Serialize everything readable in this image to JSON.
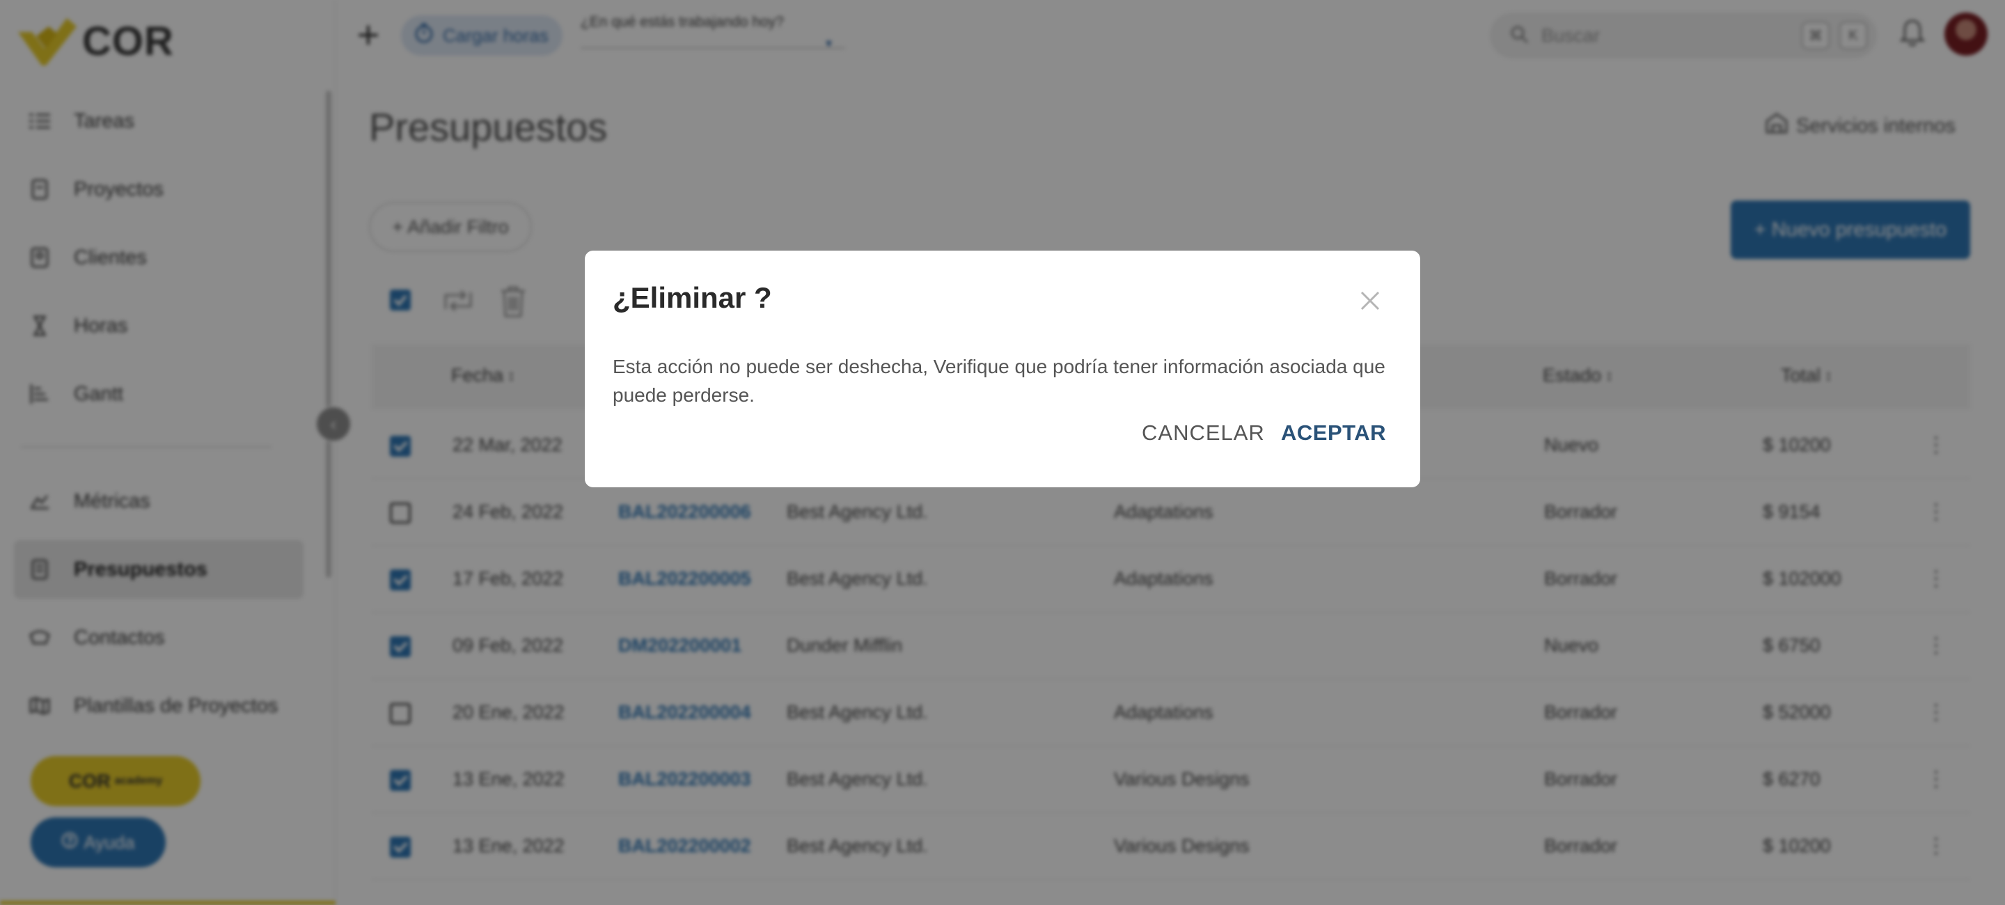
{
  "app": {
    "logo_text": "COR",
    "brand_color": "#e8cc2a",
    "accent_color": "#2f77b5"
  },
  "sidebar": {
    "items": [
      {
        "label": "Tareas",
        "icon": "tasks-icon",
        "active": false
      },
      {
        "label": "Proyectos",
        "icon": "projects-icon",
        "active": false
      },
      {
        "label": "Clientes",
        "icon": "clients-icon",
        "active": false
      },
      {
        "label": "Horas",
        "icon": "hourglass-icon",
        "active": false
      },
      {
        "label": "Gantt",
        "icon": "gantt-icon",
        "active": false
      },
      {
        "label": "Métricas",
        "icon": "metrics-icon",
        "active": false
      },
      {
        "label": "Presupuestos",
        "icon": "budget-icon",
        "active": true
      },
      {
        "label": "Contactos",
        "icon": "contacts-icon",
        "active": false
      },
      {
        "label": "Plantillas de Proyectos",
        "icon": "templates-icon",
        "active": false
      }
    ],
    "academy_label": "COR",
    "academy_small": "academy",
    "help_label": "Ayuda"
  },
  "topbar": {
    "cargar_label": "Cargar horas",
    "working_placeholder": "¿En qué estás trabajando hoy?",
    "search_placeholder": "Buscar",
    "kbd_cmd": "⌘",
    "kbd_k": "K"
  },
  "main": {
    "title": "Presupuestos",
    "internal_services": "Servicios internos",
    "add_filter": "+ Añadir Filtro",
    "new_budget": "+ Nuevo presupuesto",
    "columns": {
      "fecha": "Fecha",
      "estado": "Estado",
      "total": "Total"
    },
    "rows": [
      {
        "checked": true,
        "date": "22 Mar, 2022",
        "code": "",
        "client": "",
        "project": "",
        "status": "Nuevo",
        "total": "$ 10200"
      },
      {
        "checked": false,
        "date": "24 Feb, 2022",
        "code": "BAL202200006",
        "client": "Best Agency Ltd.",
        "project": "Adaptations",
        "status": "Borrador",
        "total": "$ 9154"
      },
      {
        "checked": true,
        "date": "17 Feb, 2022",
        "code": "BAL202200005",
        "client": "Best Agency Ltd.",
        "project": "Adaptations",
        "status": "Borrador",
        "total": "$ 102000"
      },
      {
        "checked": true,
        "date": "09 Feb, 2022",
        "code": "DM202200001",
        "client": "Dunder Mifflin",
        "project": "",
        "status": "Nuevo",
        "total": "$ 6750"
      },
      {
        "checked": false,
        "date": "20 Ene, 2022",
        "code": "BAL202200004",
        "client": "Best Agency Ltd.",
        "project": "Adaptations",
        "status": "Borrador",
        "total": "$ 52000"
      },
      {
        "checked": true,
        "date": "13 Ene, 2022",
        "code": "BAL202200003",
        "client": "Best Agency Ltd.",
        "project": "Various Designs",
        "status": "Borrador",
        "total": "$ 6270"
      },
      {
        "checked": true,
        "date": "13 Ene, 2022",
        "code": "BAL202200002",
        "client": "Best Agency Ltd.",
        "project": "Various Designs",
        "status": "Borrador",
        "total": "$ 10200"
      }
    ]
  },
  "modal": {
    "title": "¿Eliminar ?",
    "message": "Esta acción no puede ser deshecha, Verifique que podría tener información asociada que puede perderse.",
    "cancel_label": "CANCELAR",
    "accept_label": "ACEPTAR"
  }
}
